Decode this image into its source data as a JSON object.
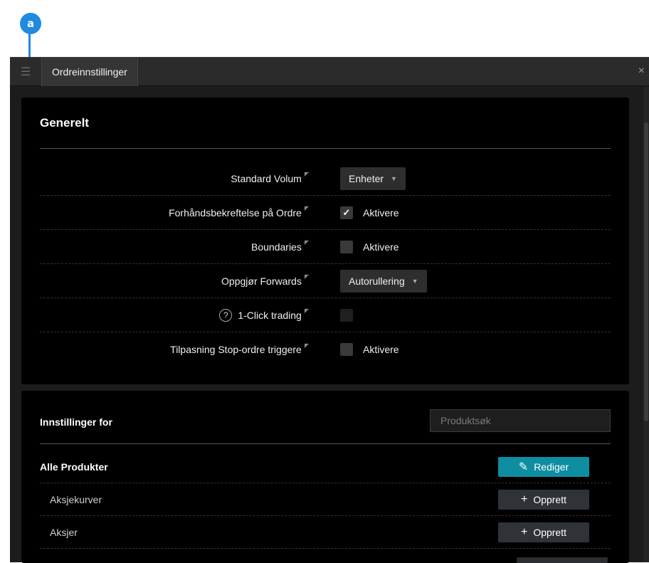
{
  "annotation": {
    "badge": "a"
  },
  "window": {
    "tab_title": "Ordreinnstillinger",
    "menu_icon": "menu-icon",
    "close_label": "×"
  },
  "general": {
    "title": "Generelt",
    "rows": [
      {
        "label": "Standard Volum",
        "type": "select",
        "value": "Enheter"
      },
      {
        "label": "Forhåndsbekreftelse på Ordre",
        "type": "checkbox",
        "checked": true,
        "check_label": "Aktivere"
      },
      {
        "label": "Boundaries",
        "type": "checkbox",
        "checked": false,
        "check_label": "Aktivere"
      },
      {
        "label": "Oppgjør Forwards",
        "type": "select",
        "value": "Autorullering"
      },
      {
        "label": "1-Click trading",
        "type": "checkbox",
        "checked": false,
        "check_label": "",
        "help": "?"
      },
      {
        "label": "Tilpasning Stop-ordre triggere",
        "type": "checkbox",
        "checked": false,
        "check_label": "Aktivere"
      }
    ]
  },
  "products": {
    "header": "Innstillinger for",
    "search_placeholder": "Produktsøk",
    "rows": [
      {
        "name": "Alle Produkter",
        "action": "Rediger",
        "action_icon": "pencil-icon"
      },
      {
        "name": "Aksjekurver",
        "action": "Opprett",
        "action_icon": "plus-icon"
      },
      {
        "name": "Aksjer",
        "action": "Opprett",
        "action_icon": "plus-icon"
      }
    ]
  },
  "colors": {
    "accent": "#1f8ae0",
    "edit_button": "#0f8ea1",
    "panel": "#000000",
    "background": "#1c1c1c"
  }
}
